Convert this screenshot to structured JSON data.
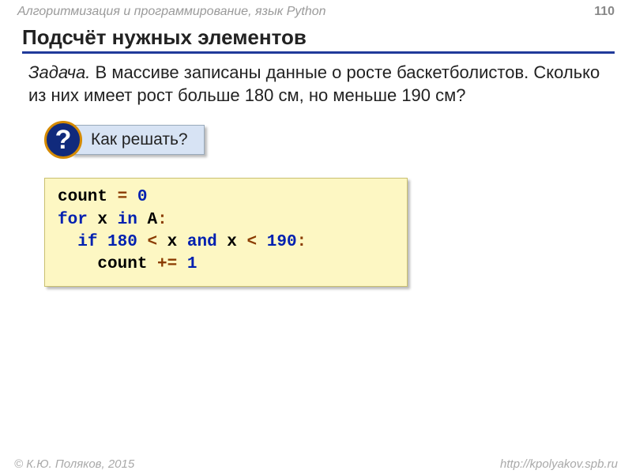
{
  "header": {
    "course": "Алгоритмизация и программирование, язык Python",
    "page": "110"
  },
  "title": "Подсчёт нужных элементов",
  "task": {
    "lead": "Задача.",
    "text": "В массиве записаны данные о росте баскетболистов. Сколько из них имеет рост больше 180 см, но меньше 190 см?"
  },
  "hint": {
    "badge": "?",
    "text": "Как решать?"
  },
  "code": {
    "tokens": [
      {
        "t": "count ",
        "c": "black"
      },
      {
        "t": "=",
        "c": "brown"
      },
      {
        "t": " ",
        "c": "black"
      },
      {
        "t": "0",
        "c": "blue"
      },
      {
        "t": "\n",
        "c": "black"
      },
      {
        "t": "for",
        "c": "blue"
      },
      {
        "t": " x ",
        "c": "black"
      },
      {
        "t": "in",
        "c": "blue"
      },
      {
        "t": " A",
        "c": "black"
      },
      {
        "t": ":",
        "c": "brown"
      },
      {
        "t": "\n",
        "c": "black"
      },
      {
        "t": "  ",
        "c": "black"
      },
      {
        "t": "if",
        "c": "blue"
      },
      {
        "t": " ",
        "c": "black"
      },
      {
        "t": "180",
        "c": "blue"
      },
      {
        "t": " ",
        "c": "black"
      },
      {
        "t": "<",
        "c": "brown"
      },
      {
        "t": " x ",
        "c": "black"
      },
      {
        "t": "and",
        "c": "blue"
      },
      {
        "t": " x ",
        "c": "black"
      },
      {
        "t": "<",
        "c": "brown"
      },
      {
        "t": " ",
        "c": "black"
      },
      {
        "t": "190",
        "c": "blue"
      },
      {
        "t": ":",
        "c": "brown"
      },
      {
        "t": "\n",
        "c": "black"
      },
      {
        "t": "    count ",
        "c": "black"
      },
      {
        "t": "+=",
        "c": "brown"
      },
      {
        "t": " ",
        "c": "black"
      },
      {
        "t": "1",
        "c": "blue"
      }
    ]
  },
  "footer": {
    "left": "© К.Ю. Поляков, 2015",
    "right": "http://kpolyakov.spb.ru"
  }
}
